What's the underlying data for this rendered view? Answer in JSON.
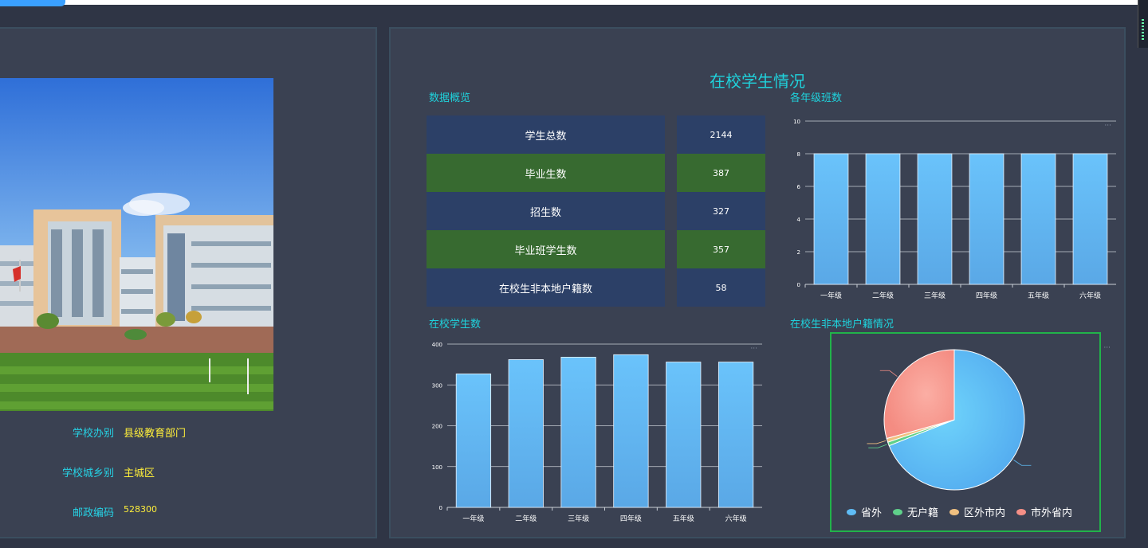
{
  "school_info": {
    "rows": [
      {
        "label": "学校办别",
        "value": "县级教育部门"
      },
      {
        "label": "学校城乡别",
        "value": "主城区"
      },
      {
        "label": "邮政编码",
        "value": "528300"
      }
    ]
  },
  "students_panel": {
    "title": "在校学生情况",
    "overview": {
      "title": "数据概览",
      "rows": [
        {
          "name": "学生总数",
          "value": "2144",
          "style": "blue"
        },
        {
          "name": "毕业生数",
          "value": "387",
          "style": "green"
        },
        {
          "name": "招生数",
          "value": "327",
          "style": "blue"
        },
        {
          "name": "毕业班学生数",
          "value": "357",
          "style": "green"
        },
        {
          "name": "在校生非本地户籍数",
          "value": "58",
          "style": "blue"
        }
      ]
    }
  },
  "colors": {
    "accent": "#1fd2dc",
    "info_value": "#ffef3a",
    "bar": "#5fb6f2",
    "row_blue": "#2c4067",
    "row_green": "#376a30",
    "pie_border": "#21b34a"
  },
  "chart_data": [
    {
      "type": "bar",
      "title": "各年级班数",
      "categories": [
        "一年级",
        "二年级",
        "三年级",
        "四年级",
        "五年级",
        "六年级"
      ],
      "values": [
        8,
        8,
        8,
        8,
        8,
        8
      ],
      "ylim": [
        0,
        10
      ],
      "yticks": [
        0,
        2,
        4,
        6,
        8,
        10
      ],
      "grid": true
    },
    {
      "type": "bar",
      "title": "在校学生数",
      "categories": [
        "一年级",
        "二年级",
        "三年级",
        "四年级",
        "五年级",
        "六年级"
      ],
      "values": [
        327,
        362,
        368,
        374,
        356,
        356
      ],
      "ylim": [
        0,
        400
      ],
      "yticks": [
        0,
        100,
        200,
        300,
        400
      ],
      "grid": true
    },
    {
      "type": "pie",
      "title": "在校生非本地户籍情况",
      "categories": [
        "省外",
        "无户籍",
        "区外市内",
        "市外省内"
      ],
      "values": [
        40,
        0.5,
        0.5,
        17
      ],
      "colors": [
        "#5fbcf5",
        "#5fd08a",
        "#f0c080",
        "#f58f86"
      ],
      "legend": "bottom"
    }
  ]
}
